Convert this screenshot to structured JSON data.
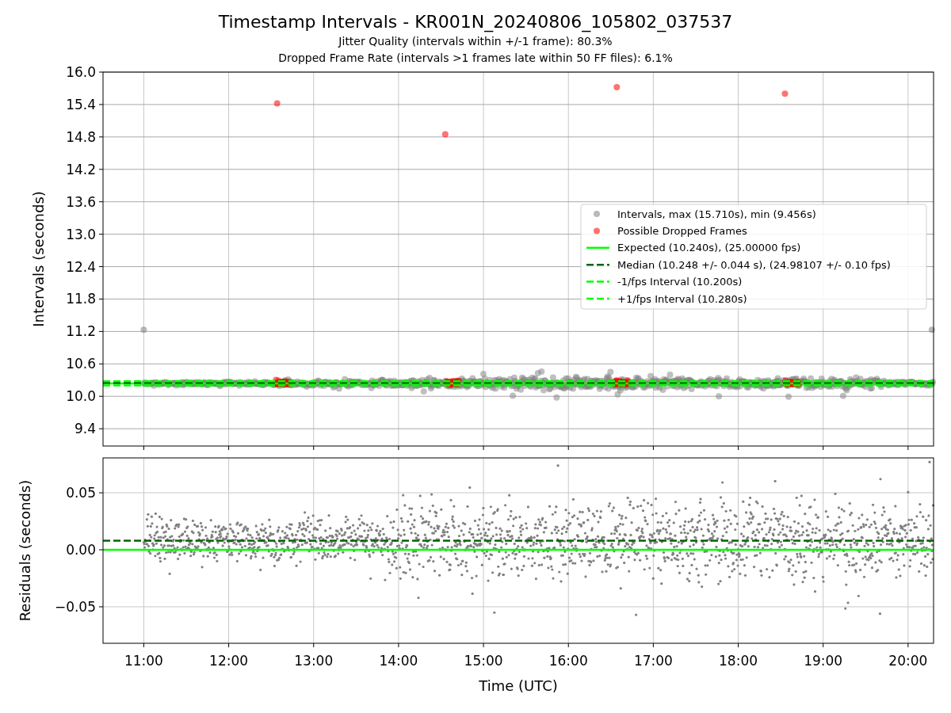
{
  "title": "Timestamp Intervals - KR001N_20240806_105802_037537",
  "subtitles": [
    "Jitter Quality (intervals within +/-1 frame): 80.3%",
    "Dropped Frame Rate (intervals >1 frames late within 50 FF files): 6.1%"
  ],
  "intervals_plot": {
    "chart_data": {
      "type": "scatter",
      "ylabel": "Intervals (seconds)",
      "grid": true,
      "legend": true,
      "xlim": [
        10.52,
        20.3
      ],
      "ylim": [
        9.08,
        16.0
      ],
      "yticks": [
        {
          "value": 9.4,
          "label": "9.4"
        },
        {
          "value": 10.0,
          "label": "10.0"
        },
        {
          "value": 10.6,
          "label": "10.6"
        },
        {
          "value": 11.2,
          "label": "11.2"
        },
        {
          "value": 11.8,
          "label": "11.8"
        },
        {
          "value": 12.4,
          "label": "12.4"
        },
        {
          "value": 13.0,
          "label": "13.0"
        },
        {
          "value": 13.6,
          "label": "13.6"
        },
        {
          "value": 14.2,
          "label": "14.2"
        },
        {
          "value": 14.8,
          "label": "14.8"
        },
        {
          "value": 15.4,
          "label": "15.4"
        },
        {
          "value": 16.0,
          "label": "16.0"
        }
      ],
      "series": [
        {
          "name": "Intervals, max (15.710s), min (9.456s)",
          "color": "#808080",
          "x": [
            11.0,
            20.28
          ],
          "values": [
            11.23,
            11.23
          ]
        },
        {
          "name": "Possible Dropped Frames",
          "color": "#ff0000",
          "x": [
            12.57,
            14.55,
            16.57,
            18.55
          ],
          "values": [
            15.42,
            14.85,
            15.72,
            15.6
          ]
        }
      ],
      "ref_lines": [
        {
          "axis": "y",
          "value": 10.24,
          "label": "Expected (10.240s), (25.00000 fps)",
          "color": "#00ff00"
        },
        {
          "axis": "y",
          "value": 10.248,
          "label": "Median (10.248 +/- 0.044 s), (24.98107 +/- 0.10 fps)",
          "color": "#006400"
        },
        {
          "axis": "y",
          "value": 10.2,
          "label": "-1/fps Interval (10.200s)",
          "color": "#00ff00"
        },
        {
          "axis": "y",
          "value": 10.28,
          "label": "+1/fps Interval (10.280s)",
          "color": "#00ff00"
        }
      ]
    }
  },
  "residuals_plot": {
    "chart_data": {
      "type": "scatter",
      "xlabel": "Time (UTC)",
      "ylabel": "Residuals (seconds)",
      "grid": true,
      "xlim": [
        10.52,
        20.3
      ],
      "ylim": [
        -0.082,
        0.0806
      ],
      "xticks": [
        {
          "value": 11,
          "label": "11:00"
        },
        {
          "value": 12,
          "label": "12:00"
        },
        {
          "value": 13,
          "label": "13:00"
        },
        {
          "value": 14,
          "label": "14:00"
        },
        {
          "value": 15,
          "label": "15:00"
        },
        {
          "value": 16,
          "label": "16:00"
        },
        {
          "value": 17,
          "label": "17:00"
        },
        {
          "value": 18,
          "label": "18:00"
        },
        {
          "value": 19,
          "label": "19:00"
        },
        {
          "value": 20,
          "label": "20:00"
        }
      ],
      "yticks": [
        {
          "value": 0.05,
          "label": "0.05"
        },
        {
          "value": 0,
          "label": "0.00"
        },
        {
          "value": -0.05,
          "label": "−0.05"
        }
      ],
      "ref_lines": [
        {
          "axis": "y",
          "value": 0,
          "color": "#00ff00"
        },
        {
          "axis": "y",
          "value": 0.008,
          "color": "#006400"
        }
      ]
    }
  }
}
